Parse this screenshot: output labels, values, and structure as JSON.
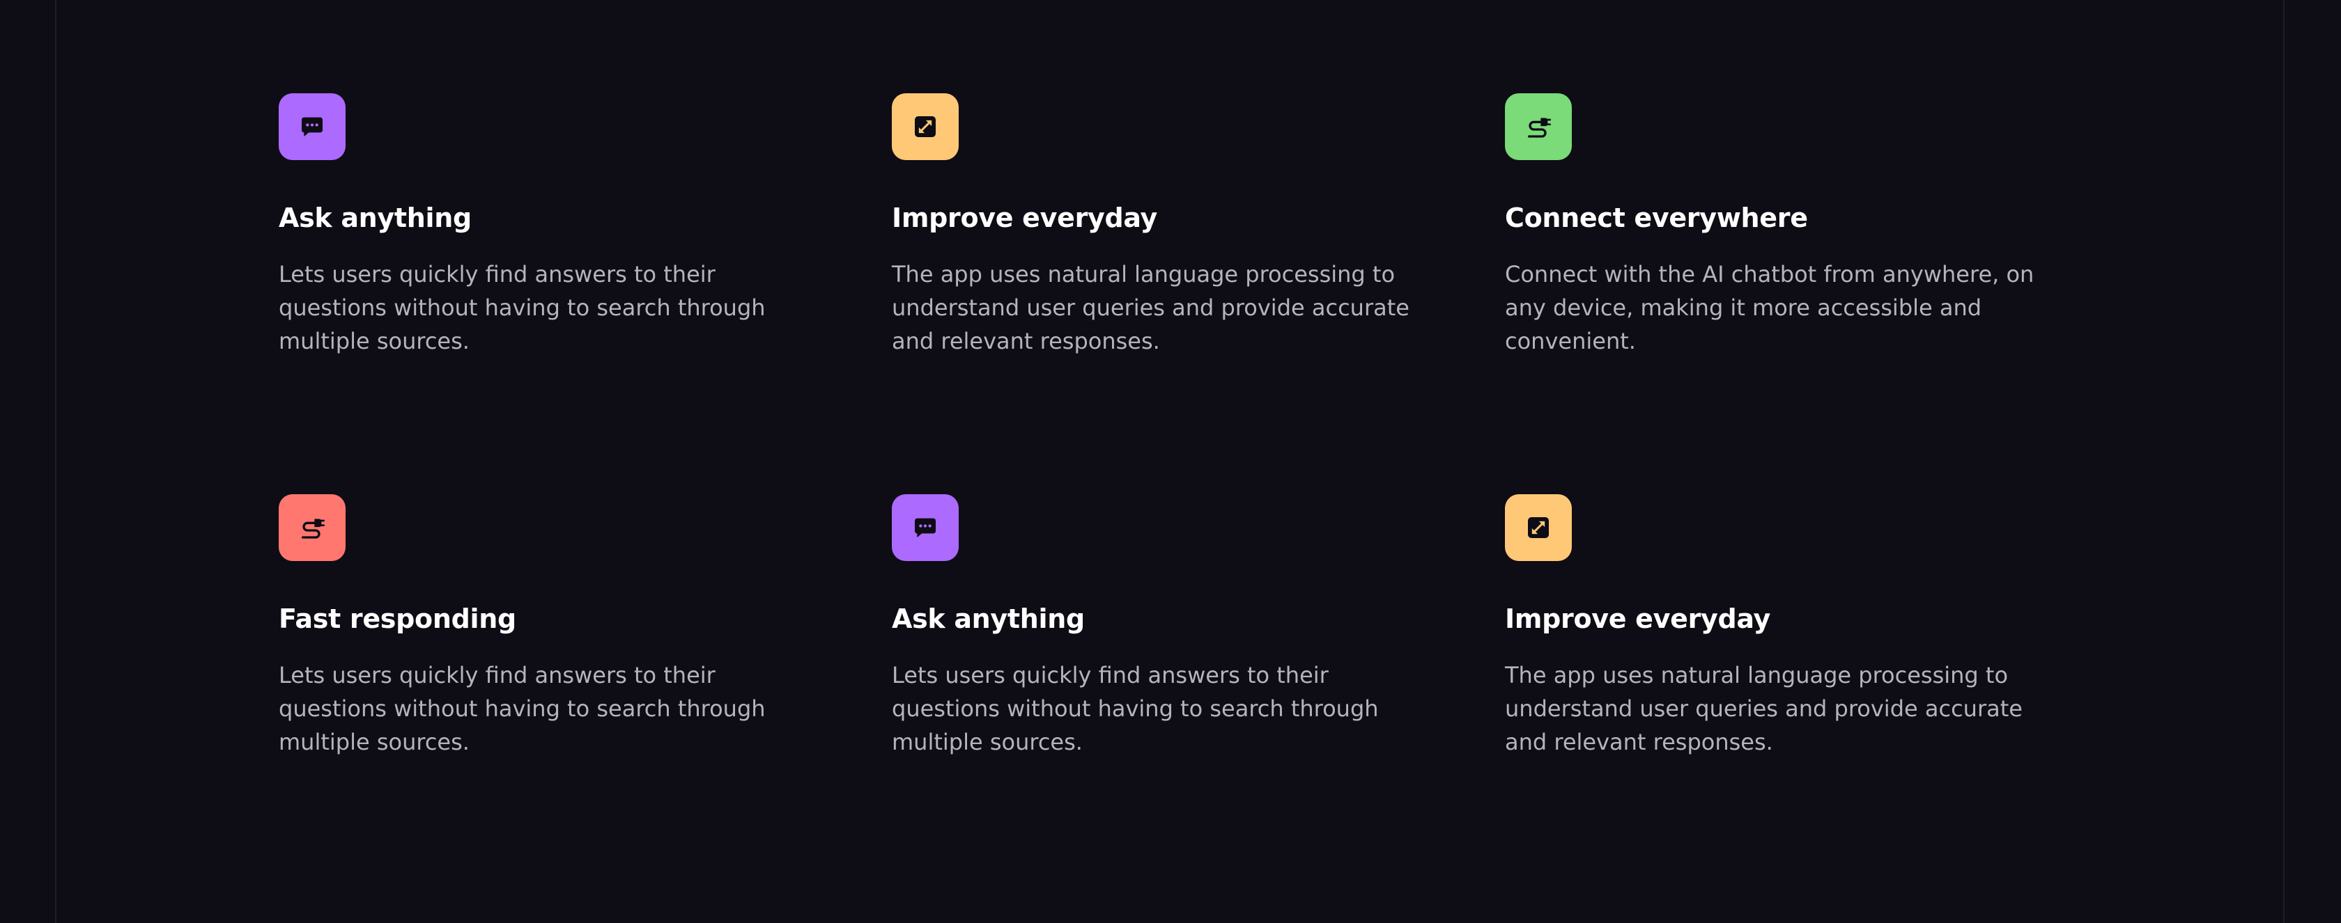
{
  "colors": {
    "background": "#0e0c15",
    "purple": "#ac6aff",
    "amber": "#ffc876",
    "green": "#7adb78",
    "red": "#ff776f",
    "icon_ink": "#0e0c15"
  },
  "features": [
    {
      "icon": "chat-bubble-icon",
      "color": "#ac6aff",
      "title": "Ask anything",
      "text": "Lets users quickly find answers to their questions without having to search through multiple sources."
    },
    {
      "icon": "expand-arrows-icon",
      "color": "#ffc876",
      "title": "Improve everyday",
      "text": "The app uses natural language processing to understand user queries and provide accurate and relevant responses."
    },
    {
      "icon": "plug-cable-icon",
      "color": "#7adb78",
      "title": "Connect everywhere",
      "text": "Connect with the AI chatbot from anywhere, on any device, making it more accessible and convenient."
    },
    {
      "icon": "plug-cable-icon",
      "color": "#ff776f",
      "title": "Fast responding",
      "text": "Lets users quickly find answers to their questions without having to search through multiple sources."
    },
    {
      "icon": "chat-bubble-icon",
      "color": "#ac6aff",
      "title": "Ask anything",
      "text": "Lets users quickly find answers to their questions without having to search through multiple sources."
    },
    {
      "icon": "expand-arrows-icon",
      "color": "#ffc876",
      "title": "Improve everyday",
      "text": "The app uses natural language processing to understand user queries and provide accurate and relevant responses."
    }
  ]
}
